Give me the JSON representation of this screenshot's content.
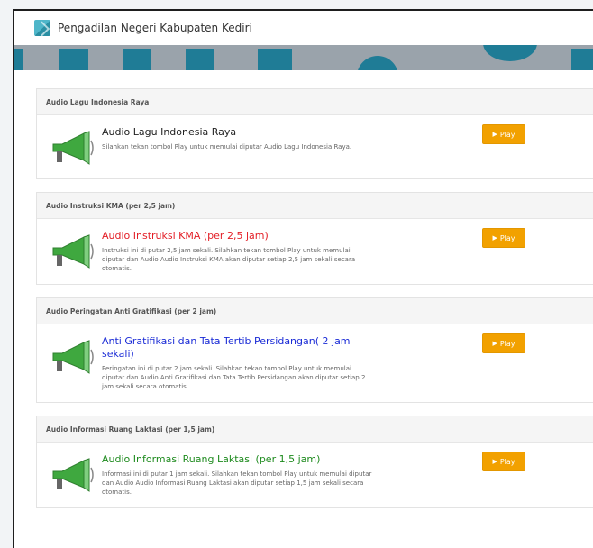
{
  "app": {
    "title": "Pengadilan Negeri Kabupaten Kediri"
  },
  "colors": {
    "accent": "#1f7c96",
    "play_button": "#f2a100",
    "title_black": "#222222",
    "title_red": "#e31d25",
    "title_blue": "#1a2bd6",
    "title_green": "#1d8a1d"
  },
  "play_icon": "play-triangle-icon",
  "panels": [
    {
      "header": "Audio Lagu Indonesia Raya",
      "title": "Audio Lagu Indonesia Raya",
      "description": "Silahkan tekan tombol Play untuk memulai diputar Audio Lagu Indonesia Raya.",
      "button_label": "Play",
      "title_color": "#222222"
    },
    {
      "header": "Audio Instruksi KMA (per 2,5 jam)",
      "title": "Audio Instruksi KMA (per 2,5 jam)",
      "description": "Instruksi ini di putar 2,5 jam sekali. Silahkan tekan tombol Play untuk memulai diputar dan Audio Audio Instruksi KMA akan diputar setiap 2,5 jam sekali secara otomatis.",
      "button_label": "Play",
      "title_color": "#e31d25"
    },
    {
      "header": "Audio Peringatan Anti Gratifikasi (per 2 jam)",
      "title": "Anti Gratifikasi dan Tata Tertib Persidangan( 2 jam sekali)",
      "description": "Peringatan ini di putar 2 jam sekali. Silahkan tekan tombol Play untuk memulai diputar dan Audio Anti Gratifikasi dan Tata Tertib Persidangan akan diputar setiap 2 jam sekali secara otomatis.",
      "button_label": "Play",
      "title_color": "#1a2bd6"
    },
    {
      "header": "Audio Informasi Ruang Laktasi (per 1,5 jam)",
      "title": "Audio Informasi Ruang Laktasi (per 1,5 jam)",
      "description": "Informasi ini di putar 1 jam sekali. Silahkan tekan tombol Play untuk memulai diputar dan Audio Audio Informasi Ruang Laktasi akan diputar setiap 1,5 jam sekali secara otomatis.",
      "button_label": "Play",
      "title_color": "#1d8a1d"
    }
  ]
}
